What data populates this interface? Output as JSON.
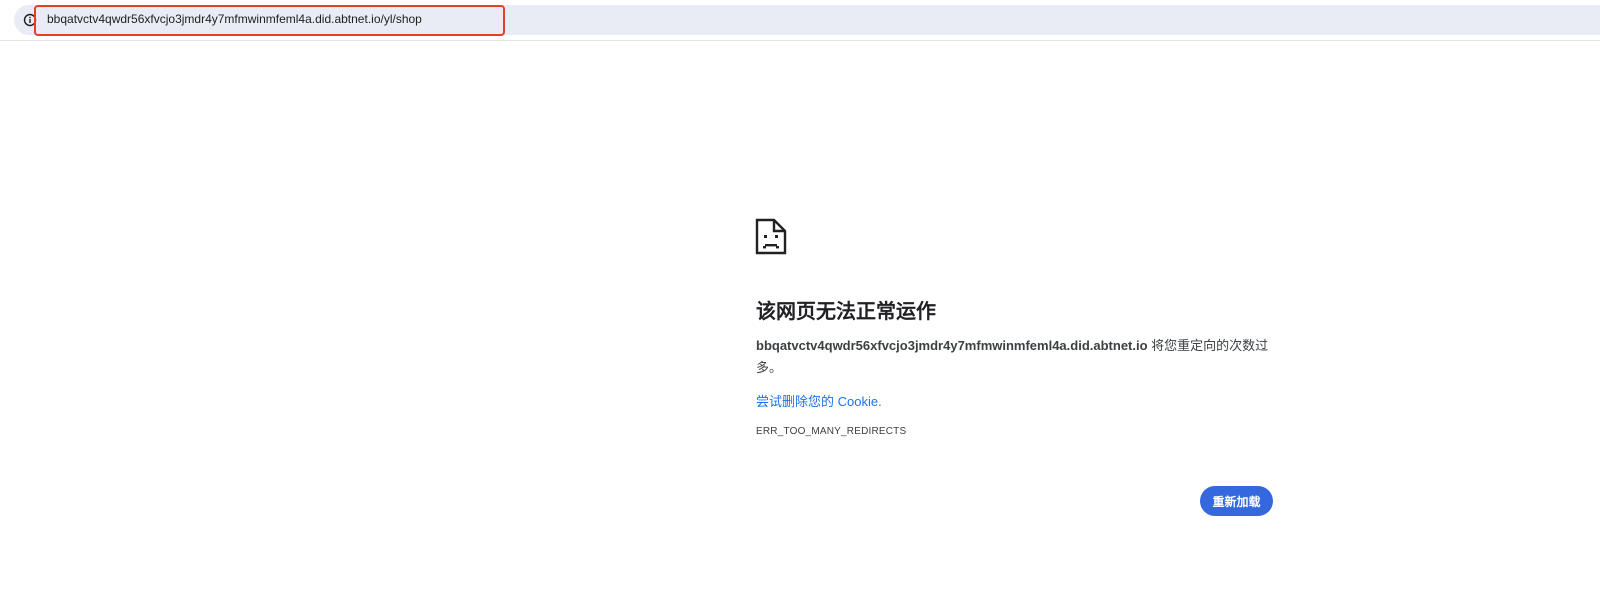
{
  "address_bar": {
    "url": "bbqatvctv4qwdr56xfvcjo3jmdr4y7mfmwinmfeml4a.did.abtnet.io/yl/shop",
    "info_icon": "info-circle-icon",
    "highlight_color": "#e53f2b"
  },
  "error_page": {
    "icon": "sad-document-icon",
    "title": "该网页无法正常运作",
    "host": "bbqatvctv4qwdr56xfvcjo3jmdr4y7mfmwinmfeml4a.did.abtnet.io",
    "message": " 将您重定向的次数过多。",
    "suggestion_link": "尝试删除您的 Cookie.",
    "error_code": "ERR_TOO_MANY_REDIRECTS",
    "reload_label": "重新加载"
  },
  "colors": {
    "link": "#1a73e8",
    "button": "#3568dc",
    "omnibox_bg": "#e9ebf5"
  }
}
